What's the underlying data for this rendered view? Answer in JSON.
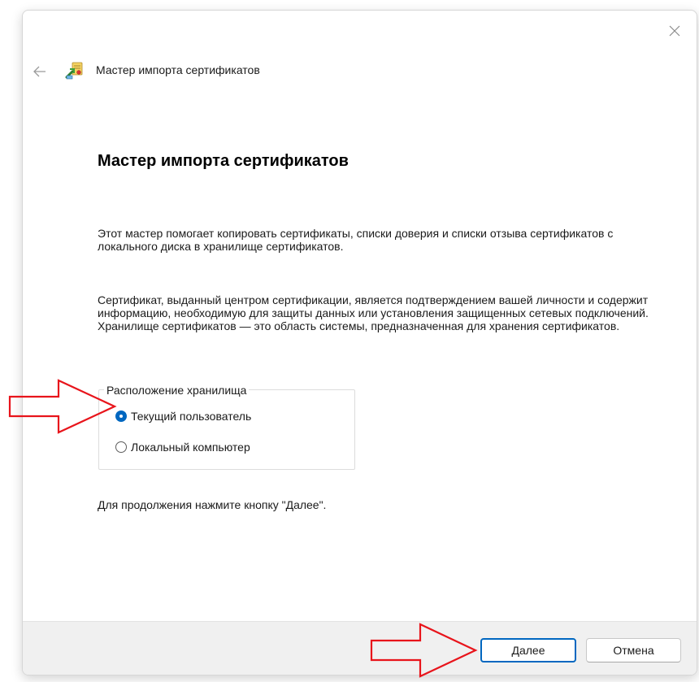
{
  "window": {
    "title": "Мастер импорта сертификатов"
  },
  "page": {
    "heading": "Мастер импорта сертификатов",
    "paragraph1": "Этот мастер помогает копировать сертификаты, списки доверия и списки отзыва сертификатов с локального диска в хранилище сертификатов.",
    "paragraph2": "Сертификат, выданный центром сертификации, является подтверждением вашей личности и содержит информацию, необходимую для защиты данных или установления защищенных сетевых подключений. Хранилище сертификатов — это область системы, предназначенная для хранения сертификатов.",
    "store_location": {
      "legend": "Расположение хранилища",
      "options": [
        {
          "label": "Текущий пользователь",
          "selected": true
        },
        {
          "label": "Локальный компьютер",
          "selected": false
        }
      ]
    },
    "hint": "Для продолжения нажмите кнопку \"Далее\"."
  },
  "footer": {
    "next_label": "Далее",
    "cancel_label": "Отмена"
  },
  "icons": {
    "back": "back-arrow-icon",
    "close": "close-icon",
    "wizard": "certificate-wizard-icon",
    "annotation": "red-pointer-arrow-icon"
  },
  "colors": {
    "accent": "#0067c0",
    "annotation": "#e8141b",
    "footer_bg": "#f0f0f0"
  }
}
